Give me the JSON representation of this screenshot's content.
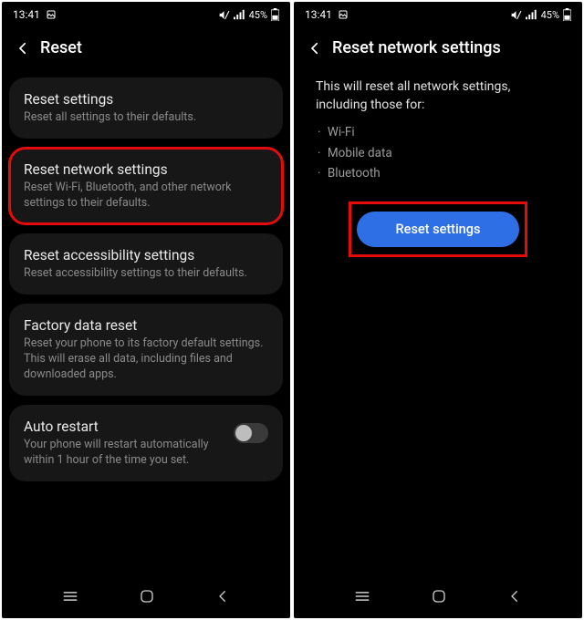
{
  "status": {
    "time": "13:41",
    "battery_text": "45%"
  },
  "left": {
    "title": "Reset",
    "items": [
      {
        "title": "Reset settings",
        "sub": "Reset all settings to their defaults."
      },
      {
        "title": "Reset network settings",
        "sub": "Reset Wi-Fi, Bluetooth, and other network settings to their defaults."
      },
      {
        "title": "Reset accessibility settings",
        "sub": "Reset accessibility settings to their defaults."
      },
      {
        "title": "Factory data reset",
        "sub": "Reset your phone to its factory default settings. This will erase all data, including files and downloaded apps."
      },
      {
        "title": "Auto restart",
        "sub": "Your phone will restart automatically within 1 hour of the time you set."
      }
    ]
  },
  "right": {
    "title": "Reset network settings",
    "description": "This will reset all network settings, including those for:",
    "bullets": [
      "Wi-Fi",
      "Mobile data",
      "Bluetooth"
    ],
    "button_label": "Reset settings"
  }
}
